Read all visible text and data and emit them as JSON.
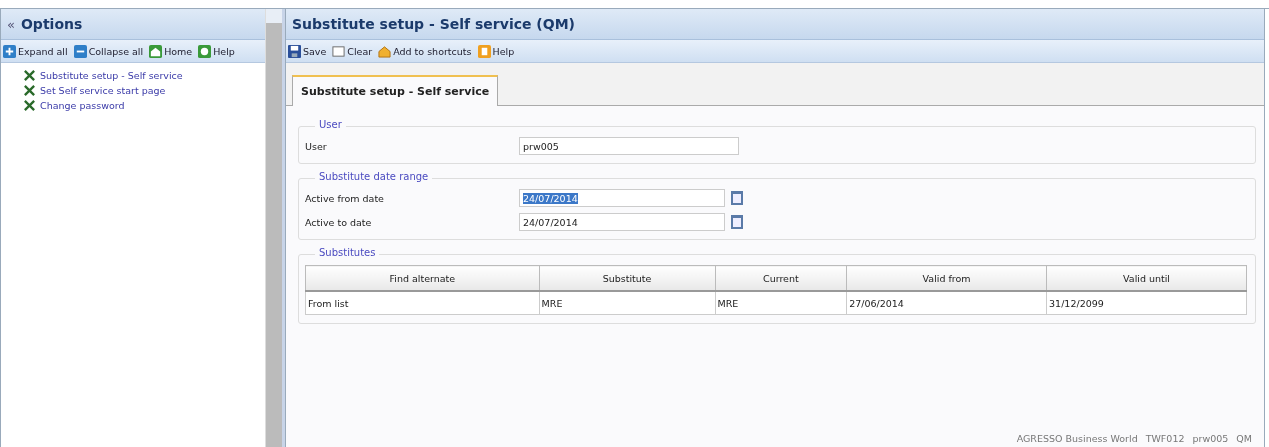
{
  "sidebar": {
    "collapse": "«",
    "title": "Options",
    "toolbar": [
      {
        "kind": "expand",
        "label": "Expand all"
      },
      {
        "kind": "collapse",
        "label": "Collapse all"
      },
      {
        "kind": "home",
        "label": "Home"
      },
      {
        "kind": "help",
        "label": "Help"
      }
    ],
    "items": [
      {
        "label": "Substitute setup - Self service"
      },
      {
        "label": "Set Self service start page"
      },
      {
        "label": "Change password"
      }
    ]
  },
  "main": {
    "title": "Substitute setup - Self service (QM)",
    "toolbar": [
      {
        "kind": "save",
        "label": "Save"
      },
      {
        "kind": "clear",
        "label": "Clear"
      },
      {
        "kind": "shortcut",
        "label": "Add to shortcuts"
      },
      {
        "kind": "help",
        "label": "Help"
      }
    ],
    "tabs": [
      {
        "label": "Substitute setup - Self service",
        "selected": true
      }
    ],
    "user_group": {
      "legend": "User",
      "label": "User",
      "value": "prw005"
    },
    "date_group": {
      "legend": "Substitute date range",
      "fields": [
        {
          "label": "Active from date",
          "value": "24/07/2014",
          "text_selected": true
        },
        {
          "label": "Active to date",
          "value": "24/07/2014",
          "text_selected": false
        }
      ]
    },
    "substitutes": {
      "legend": "Substitutes",
      "columns": [
        "Find alternate",
        "Substitute",
        "Current",
        "Valid from",
        "Valid until"
      ],
      "rows": [
        [
          "From list",
          "MRE",
          "MRE",
          "27/06/2014",
          "31/12/2099"
        ]
      ]
    },
    "status_bar": [
      "AGRESSO Business World",
      "TWF012",
      "prw005",
      "QM"
    ]
  }
}
